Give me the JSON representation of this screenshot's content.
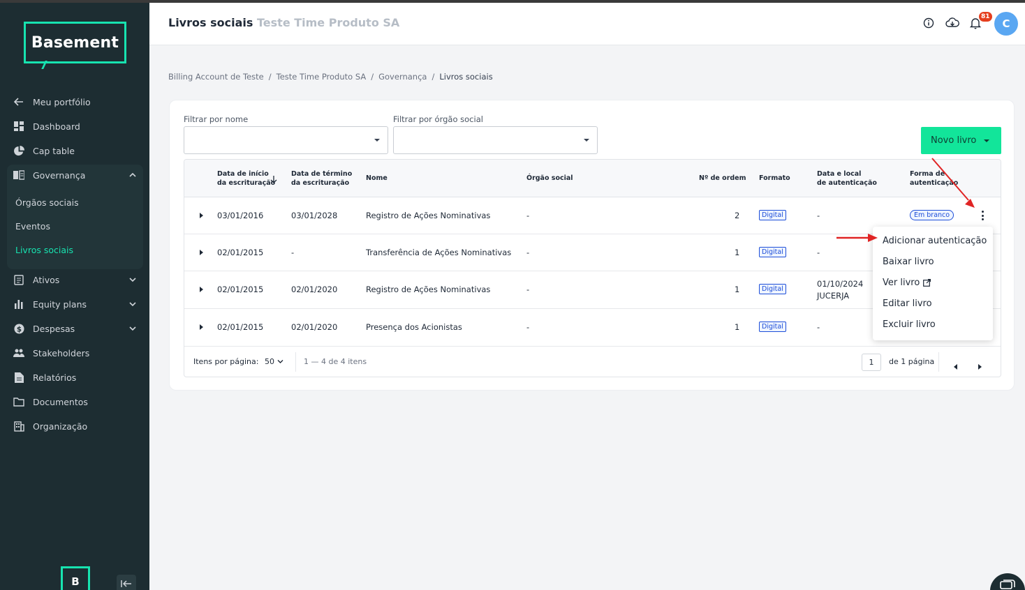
{
  "app": {
    "logo_text": "Basement",
    "collapsed_logo": "B"
  },
  "sidebar": {
    "items": [
      {
        "label": "Meu portfólio",
        "icon": "arrow-left-icon"
      },
      {
        "label": "Dashboard",
        "icon": "dashboard-icon"
      },
      {
        "label": "Cap table",
        "icon": "pie-chart-icon"
      },
      {
        "label": "Governança",
        "icon": "book-icon",
        "expanded": true
      },
      {
        "label": "Ativos",
        "icon": "document-list-icon"
      },
      {
        "label": "Equity plans",
        "icon": "bar-chart-icon"
      },
      {
        "label": "Despesas",
        "icon": "dollar-icon"
      },
      {
        "label": "Stakeholders",
        "icon": "people-icon"
      },
      {
        "label": "Relatórios",
        "icon": "report-icon"
      },
      {
        "label": "Documentos",
        "icon": "folder-icon"
      },
      {
        "label": "Organização",
        "icon": "building-icon"
      }
    ],
    "governanca_sub": [
      {
        "label": "Órgãos sociais"
      },
      {
        "label": "Eventos"
      },
      {
        "label": "Livros sociais",
        "active": true
      }
    ]
  },
  "header": {
    "title": "Livros sociais",
    "company": "Teste Time Produto SA",
    "notification_count": "81",
    "avatar_initial": "C"
  },
  "breadcrumb": {
    "items": [
      "Billing Account de Teste",
      "Teste Time Produto SA",
      "Governança",
      "Livros sociais"
    ],
    "separator": "/"
  },
  "filters": {
    "name_label": "Filtrar por nome",
    "name_value": "",
    "organ_label": "Filtrar por órgão social",
    "organ_value": "",
    "new_button": "Novo livro"
  },
  "table": {
    "columns": {
      "start_1": "Data de início",
      "start_2": "da escrituração",
      "end_1": "Data de término",
      "end_2": "da escrituração",
      "name": "Nome",
      "organ": "Órgão social",
      "order": "Nº de ordem",
      "format": "Formato",
      "auth_1": "Data e local",
      "auth_2": "de autenticação",
      "form_1": "Forma de",
      "form_2": "autenticação"
    },
    "rows": [
      {
        "start": "03/01/2016",
        "end": "03/01/2028",
        "name": "Registro de Ações Nominativas",
        "organ": "-",
        "order": "2",
        "format": "Digital",
        "auth_date": "-",
        "auth_place": "",
        "auth_form": "Em branco"
      },
      {
        "start": "02/01/2015",
        "end": "-",
        "name": "Transferência de Ações Nominativas",
        "organ": "-",
        "order": "1",
        "format": "Digital",
        "auth_date": "-",
        "auth_place": "",
        "auth_form": ""
      },
      {
        "start": "02/01/2015",
        "end": "02/01/2020",
        "name": "Registro de Ações Nominativas",
        "organ": "-",
        "order": "1",
        "format": "Digital",
        "auth_date": "01/10/2024",
        "auth_place": "JUCERJA",
        "auth_form": ""
      },
      {
        "start": "02/01/2015",
        "end": "02/01/2020",
        "name": "Presença dos Acionistas",
        "organ": "-",
        "order": "1",
        "format": "Digital",
        "auth_date": "-",
        "auth_place": "",
        "auth_form": ""
      }
    ],
    "footer": {
      "per_page_label": "Itens por página:",
      "per_page_value": "50",
      "range": "1 — 4 de 4 itens",
      "page": "1",
      "page_total": "de 1 página"
    }
  },
  "row_menu": {
    "items": [
      "Adicionar autenticação",
      "Baixar livro",
      "Ver livro",
      "Editar livro",
      "Excluir livro"
    ]
  },
  "colors": {
    "accent": "#17e3b0",
    "sidebar_bg": "#1d2d32",
    "primary_button": "#12e59a",
    "annotation_arrow": "#e02424",
    "tag_blue": "#1d4ed8"
  }
}
